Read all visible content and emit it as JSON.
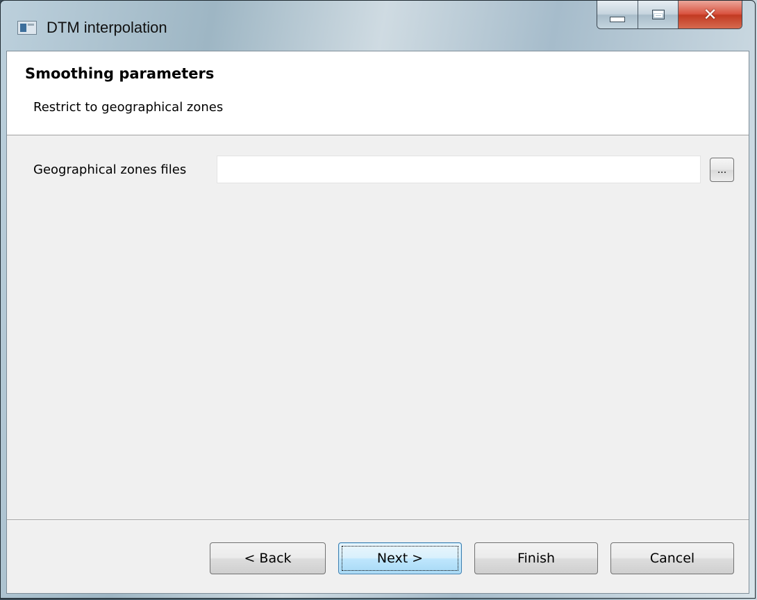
{
  "window": {
    "title": "DTM interpolation",
    "icon": "window-app-icon",
    "caption_buttons": [
      "minimize",
      "maximize",
      "close"
    ]
  },
  "header": {
    "title": "Smoothing parameters",
    "subtitle": "Restrict to geographical zones"
  },
  "form": {
    "zones_label": "Geographical zones files",
    "zones_value": "",
    "browse_label": "..."
  },
  "footer": {
    "back_label": "< Back",
    "next_label": "Next >",
    "finish_label": "Finish",
    "cancel_label": "Cancel"
  }
}
